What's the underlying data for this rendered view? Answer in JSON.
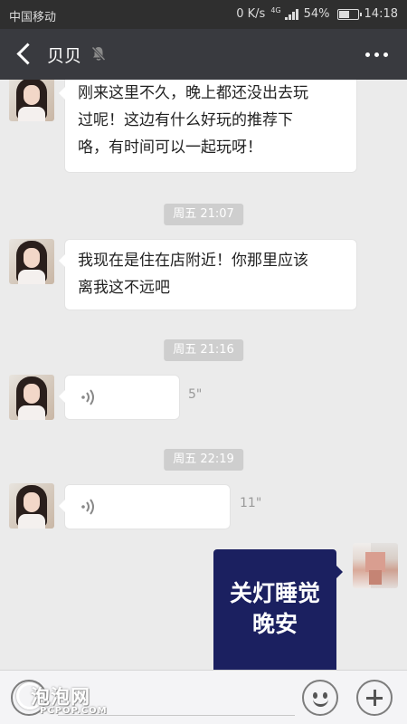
{
  "status_bar": {
    "carrier": "中国移动",
    "net_speed": "0 K/s",
    "net_type": "4G",
    "battery_text": "54%",
    "battery_level": 0.54,
    "time": "14:18"
  },
  "header": {
    "title": "贝贝",
    "icons": {
      "back": "back-arrow-icon",
      "mute": "mute-bell-icon",
      "more": "more-dots-icon"
    }
  },
  "messages": [
    {
      "type": "text",
      "from": "contact",
      "text_lines": [
        "刚来这里不久，晚上都还没出去玩",
        "过呢！这边有什么好玩的推荐下",
        "咯，有时间可以一起玩呀！"
      ]
    },
    {
      "type": "time",
      "text": "周五 21:07"
    },
    {
      "type": "text",
      "from": "contact",
      "text_lines": [
        "我现在是住在店附近！你那里应该",
        "离我这不远吧"
      ]
    },
    {
      "type": "time",
      "text": "周五 21:16"
    },
    {
      "type": "voice",
      "from": "contact",
      "duration": "5\""
    },
    {
      "type": "time",
      "text": "周五 22:19"
    },
    {
      "type": "voice",
      "from": "contact",
      "duration": "11\""
    },
    {
      "type": "image",
      "from": "self",
      "text_lines": [
        "关灯睡觉",
        "晚安"
      ]
    }
  ],
  "input_bar": {
    "text_value": "",
    "icons": {
      "voice": "voice-toggle-icon",
      "emoji": "emoji-icon",
      "plus": "plus-icon"
    }
  },
  "watermark": {
    "main": "泡泡网",
    "sub": "PCPOP.COM"
  },
  "colors": {
    "status_bar_bg": "#2f2f2f",
    "title_bar_bg": "#393a3f",
    "chat_bg": "#ebebeb",
    "bubble_bg": "#ffffff",
    "time_chip_bg": "#cecece",
    "image_msg_bg": "#1b2060"
  }
}
